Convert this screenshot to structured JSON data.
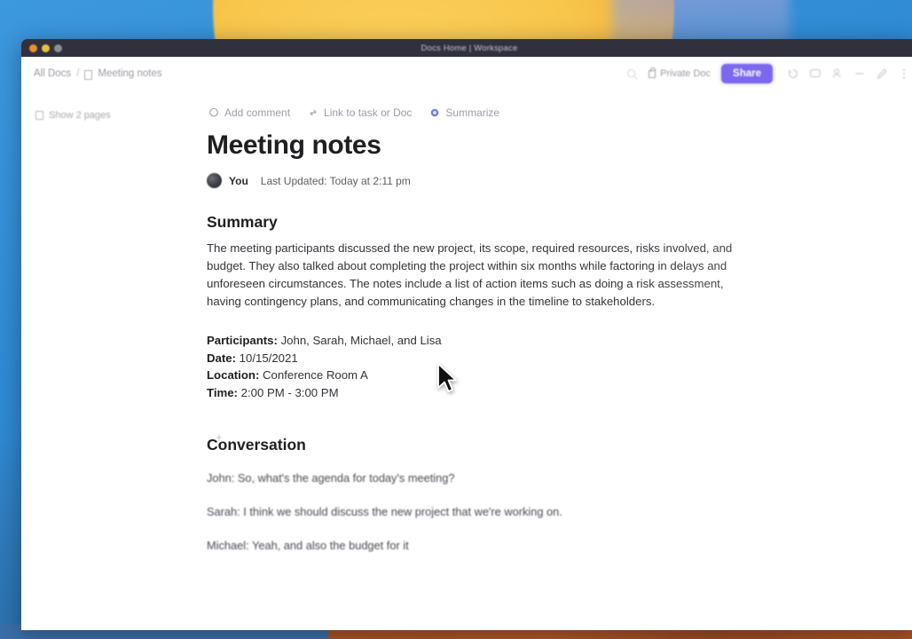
{
  "window": {
    "title": "Docs Home | Workspace",
    "traffic_lights": [
      "close-orange",
      "minimize-yellow",
      "maximize-gray"
    ]
  },
  "topbar": {
    "breadcrumb": {
      "root": "All Docs",
      "separator": "/",
      "current": "Meeting notes",
      "current_icon": "document-icon"
    },
    "privacy_label": "Private Doc",
    "privacy_icon": "lock-icon",
    "share_label": "Share",
    "share_color": "#7b68ee",
    "icons": [
      "history-icon",
      "comment-icon",
      "person-add-icon",
      "minimize-icon",
      "edit-icon",
      "more-icon"
    ]
  },
  "sidebar": {
    "show_pages_label": "Show 2 pages",
    "show_pages_icon": "pages-icon"
  },
  "doc_toolbar": [
    {
      "label": "Add comment",
      "icon": "comment-bubble-icon"
    },
    {
      "label": "Link to task or Doc",
      "icon": "link-icon"
    },
    {
      "label": "Summarize",
      "icon": "ai-sparkle-icon"
    }
  ],
  "document": {
    "title": "Meeting notes",
    "author": "You",
    "last_updated": "Last Updated: Today at 2:11 pm",
    "summary_heading": "Summary",
    "summary_text": "The meeting participants discussed the new project, its scope, required resources, risks involved, and budget. They also talked about completing the project within six months while factoring in delays and unforeseen circumstances. The notes include a list of action items such as doing a risk assessment, having contingency plans, and communicating changes in the timeline to stakeholders.",
    "meta": [
      {
        "label": "Participants:",
        "value": "John, Sarah, Michael, and Lisa"
      },
      {
        "label": "Date:",
        "value": "10/15/2021"
      },
      {
        "label": "Location:",
        "value": "Conference Room A"
      },
      {
        "label": "Time:",
        "value": "2:00 PM - 3:00 PM"
      }
    ],
    "conversation_heading": "Conversation",
    "conversation": [
      "John: So, what's the agenda for today's meeting?",
      "Sarah: I think we should discuss the new project that we're working on.",
      "Michael: Yeah, and also the budget for it"
    ],
    "gutter_add": "+"
  }
}
